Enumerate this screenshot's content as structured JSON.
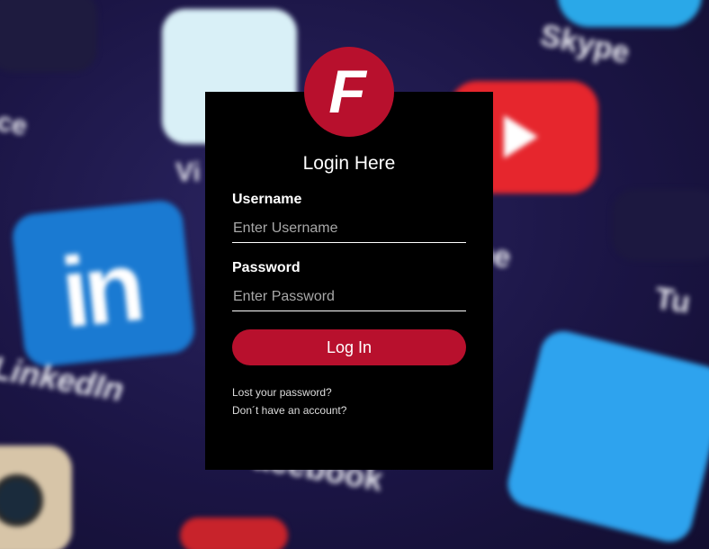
{
  "logo": {
    "letter": "F",
    "color": "#b8102d"
  },
  "form": {
    "title": "Login Here",
    "username": {
      "label": "Username",
      "placeholder": "Enter Username",
      "value": ""
    },
    "password": {
      "label": "Password",
      "placeholder": "Enter Password",
      "value": ""
    },
    "submit_label": "Log In",
    "links": {
      "lost_password": "Lost your password?",
      "no_account": "Don´t have an account?"
    }
  },
  "background": {
    "app_labels": {
      "skype": "Skype",
      "linkedin": "LinkedIn",
      "youtube_partial": "be",
      "vimeo_partial": "Vi",
      "facebook_partial": "acebook",
      "tumblr_partial": "Tu",
      "other_partial": "ace"
    }
  },
  "colors": {
    "accent": "#b8102d",
    "card": "#000000"
  }
}
